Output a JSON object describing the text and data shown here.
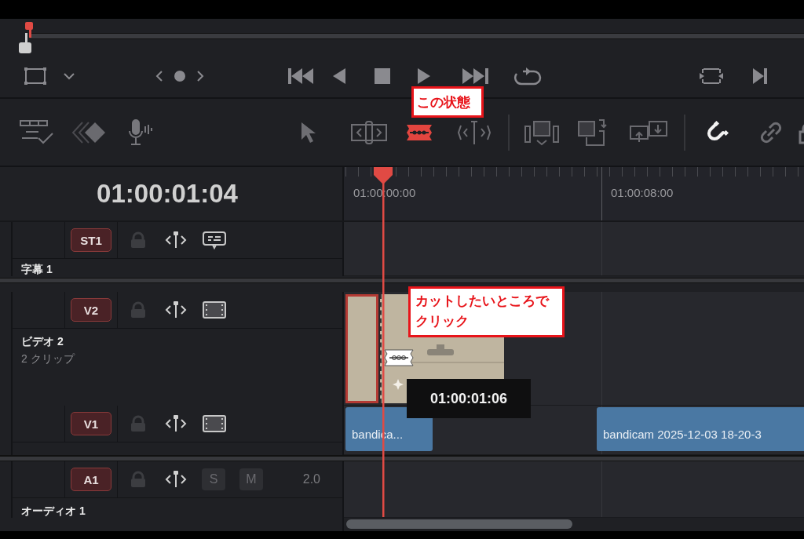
{
  "timecode": "01:00:01:04",
  "edit_tools": [
    {
      "kind": "select",
      "selected": false
    },
    {
      "kind": "trim",
      "selected": false
    },
    {
      "kind": "blade",
      "selected": true
    },
    {
      "kind": "dynamic-trim",
      "selected": false
    }
  ],
  "toggles": [
    {
      "kind": "snapping",
      "on": true
    },
    {
      "kind": "link",
      "on": false
    }
  ],
  "ruler": {
    "labels": [
      "01:00:00:00",
      "01:00:08:00"
    ]
  },
  "tracks": [
    {
      "kind": "subtitle",
      "badge": "ST1",
      "name": "字幕 1"
    },
    {
      "kind": "video",
      "badge": "V2",
      "name": "ビデオ 2",
      "info": "2 クリップ",
      "clips": [
        {
          "kind": "title",
          "selected": true
        },
        {
          "kind": "title",
          "selected": false
        }
      ]
    },
    {
      "kind": "video",
      "badge": "V1",
      "clips": [
        {
          "kind": "media",
          "label": "bandica..."
        },
        {
          "kind": "media",
          "label": "bandicam 2025-12-03 18-20-3"
        }
      ]
    },
    {
      "kind": "audio",
      "badge": "A1",
      "solo": "S",
      "mute": "M",
      "channels": "2.0",
      "name": "オーディオ 1"
    }
  ],
  "tooltip": "01:00:01:06",
  "annotations": [
    {
      "kind": "state",
      "text": "この状態"
    },
    {
      "kind": "click",
      "text": "カットしたいところでクリック"
    }
  ]
}
